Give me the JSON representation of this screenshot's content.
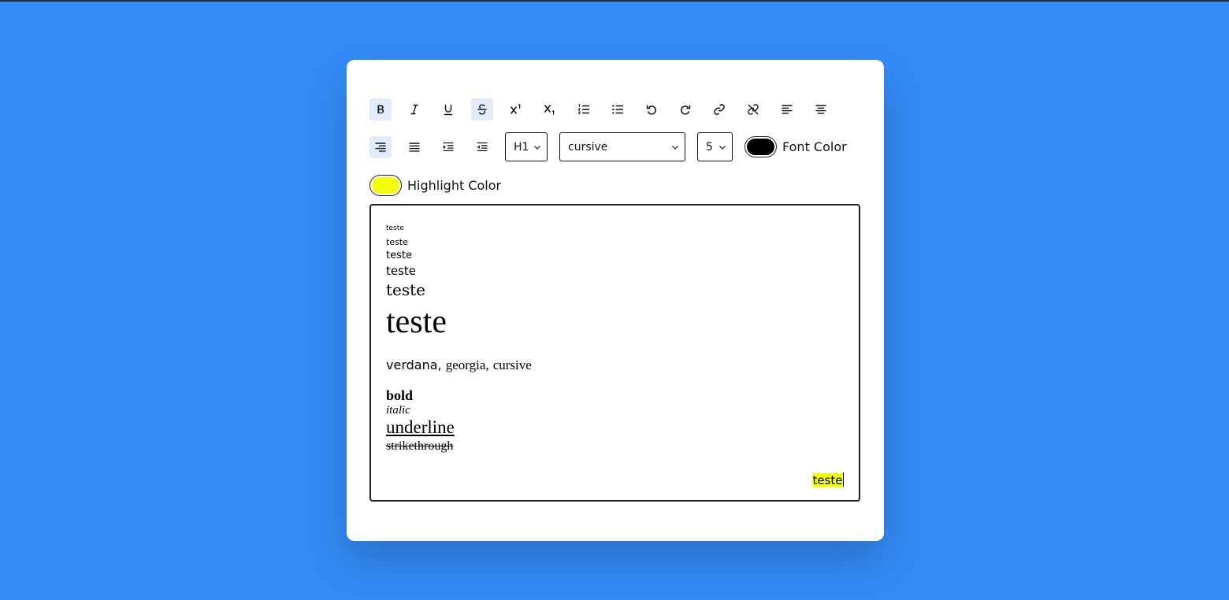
{
  "toolbar": {
    "buttons_row1": [
      {
        "name": "bold-button",
        "icon": "bold-icon",
        "active": true
      },
      {
        "name": "italic-button",
        "icon": "italic-icon",
        "active": false
      },
      {
        "name": "underline-button",
        "icon": "underline-icon",
        "active": false
      },
      {
        "name": "strikethrough-button",
        "icon": "strikethrough-icon",
        "active": true
      },
      {
        "name": "superscript-button",
        "icon": "superscript-icon",
        "active": false
      },
      {
        "name": "subscript-button",
        "icon": "subscript-icon",
        "active": false
      },
      {
        "name": "ordered-list-button",
        "icon": "ordered-list-icon",
        "active": false
      },
      {
        "name": "unordered-list-button",
        "icon": "unordered-list-icon",
        "active": false
      },
      {
        "name": "undo-button",
        "icon": "undo-icon",
        "active": false
      },
      {
        "name": "redo-button",
        "icon": "redo-icon",
        "active": false
      },
      {
        "name": "link-button",
        "icon": "link-icon",
        "active": false
      },
      {
        "name": "unlink-button",
        "icon": "unlink-icon",
        "active": false
      },
      {
        "name": "align-left-button",
        "icon": "align-left-icon",
        "active": false
      },
      {
        "name": "align-center-button",
        "icon": "align-center-icon",
        "active": false
      }
    ],
    "buttons_row2": [
      {
        "name": "align-right-button",
        "icon": "align-right-icon",
        "active": true
      },
      {
        "name": "justify-button",
        "icon": "justify-icon",
        "active": false
      },
      {
        "name": "indent-button",
        "icon": "indent-icon",
        "active": false
      },
      {
        "name": "outdent-button",
        "icon": "outdent-icon",
        "active": false
      }
    ],
    "heading_select": "H1",
    "font_select": "cursive",
    "size_select": "5",
    "font_color_label": "Font Color",
    "font_color": "#000000",
    "highlight_color_label": "Highlight Color",
    "highlight_color": "#f1ff0a"
  },
  "colors": {
    "background": "#338bf5",
    "card": "#ffffff",
    "active_button": "#e2ebfb"
  },
  "editor": {
    "size_samples": [
      "teste",
      "teste",
      "teste",
      "teste",
      "teste",
      "teste"
    ],
    "font_sample_1": "verdana,",
    "font_sample_2": "georgia,",
    "font_sample_3": "cursive",
    "bold": "bold",
    "italic": "italic",
    "underline": "underline",
    "strikethrough": "strikethrough",
    "highlighted": "teste"
  }
}
